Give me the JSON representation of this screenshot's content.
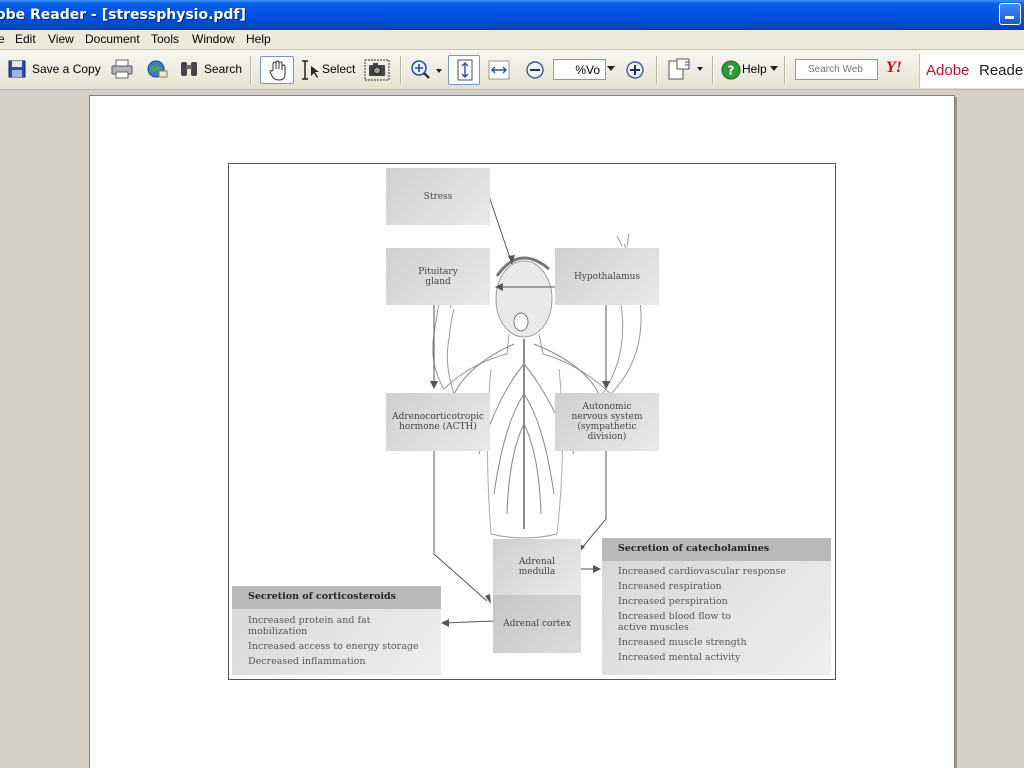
{
  "window": {
    "title": "obe Reader - [stressphysio.pdf]"
  },
  "menu": [
    "e",
    "Edit",
    "View",
    "Document",
    "Tools",
    "Window",
    "Help"
  ],
  "toolbar": {
    "save_copy": "Save a Copy",
    "search": "Search",
    "select": "Select",
    "zoom_value": "%Vo",
    "help": "Help",
    "search_web_placeholder": "Search Web",
    "yahoo": "Y!",
    "adobe_brand": "Adobe",
    "reader_brand": "Reade"
  },
  "figure": {
    "stress": "Stress",
    "pituitary": "Pituitary\ngland",
    "hypothalamus": "Hypothalamus",
    "acth": "Adrenocorticotropic\nhormone (ACTH)",
    "ans": "Autonomic\nnervous system\n(sympathetic\ndivision)",
    "medulla": "Adrenal\nmedulla",
    "cortex": "Adrenal cortex",
    "catecholamines": {
      "title": "Secretion of catecholamines",
      "items": [
        "Increased cardiovascular response",
        "Increased respiration",
        "Increased perspiration",
        "Increased blood flow to\nactive muscles",
        "Increased muscle strength",
        "Increased mental activity"
      ]
    },
    "corticosteroids": {
      "title": "Secretion of corticosteroids",
      "items": [
        "Increased protein and fat\nmobilization",
        "Increased access to energy storage",
        "Decreased inflammation"
      ]
    }
  }
}
